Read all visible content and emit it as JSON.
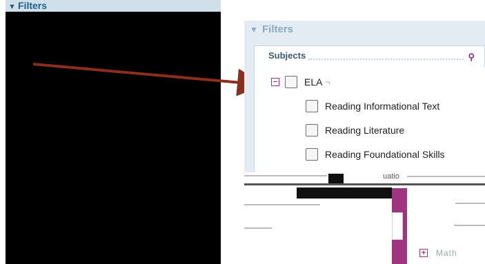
{
  "left_panel": {
    "header": {
      "label": "Filters",
      "icon": "triangle-down-icon"
    }
  },
  "right_panel": {
    "header": {
      "label": "Filters",
      "icon": "triangle-down-icon"
    },
    "subjects_label": "Subjects",
    "tree": {
      "root": {
        "label": "ELA",
        "expander": "−"
      },
      "children": [
        {
          "label": "Reading Informational Text"
        },
        {
          "label": "Reading Literature"
        },
        {
          "label": "Reading Foundational Skills"
        }
      ]
    },
    "partial_text": "uatio",
    "math": {
      "label": "Math",
      "expander": "+"
    }
  },
  "colors": {
    "arrow": "#8b2f1c",
    "accent_purple": "#a0357f",
    "header_blue": "#cfe0ea"
  }
}
